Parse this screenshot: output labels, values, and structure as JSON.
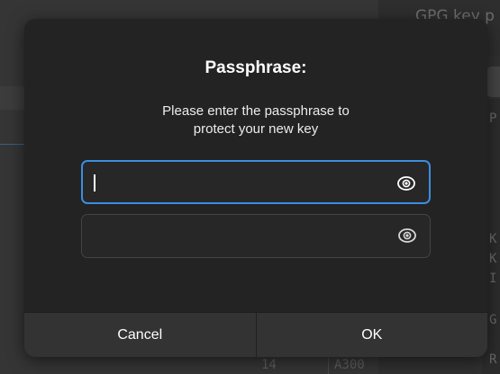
{
  "background": {
    "right_title": "GPG key p",
    "right_mono_lines": [
      "P",
      "K",
      "K",
      "I",
      "G",
      "R"
    ],
    "bottom_cells": [
      "14",
      "A300"
    ]
  },
  "dialog": {
    "title": "Passphrase:",
    "message_line1": "Please enter the passphrase to",
    "message_line2": "protect your new key",
    "passphrase_field": {
      "value": "",
      "placeholder": "",
      "icon": "eye-icon"
    },
    "confirm_field": {
      "value": "",
      "placeholder": "",
      "icon": "eye-icon"
    },
    "cancel_label": "Cancel",
    "ok_label": "OK"
  },
  "colors": {
    "accent": "#3b8ee0",
    "dialog_bg": "#232323",
    "footer_bg": "#333333"
  }
}
